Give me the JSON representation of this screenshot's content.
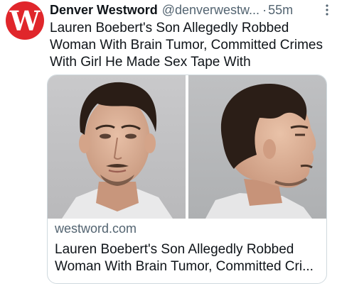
{
  "author": {
    "avatar_letter": "W",
    "avatar_color": "#e0262b",
    "display_name": "Denver Westword",
    "handle": "@denverwestw...",
    "separator": "·",
    "timestamp": "55m"
  },
  "tweet": {
    "text_lines": [
      "Lauren Boebert's Son Allegedly Robbed",
      "Woman With Brain Tumor, Committed Crimes",
      "With Girl He Made Sex Tape With"
    ]
  },
  "card": {
    "image_icon": "mugshot-photo",
    "domain": "westword.com",
    "title_lines": [
      "Lauren Boebert's Son Allegedly Robbed",
      "Woman With Brain Tumor, Committed Cri..."
    ]
  },
  "icons": {
    "more": "more-options-icon"
  }
}
